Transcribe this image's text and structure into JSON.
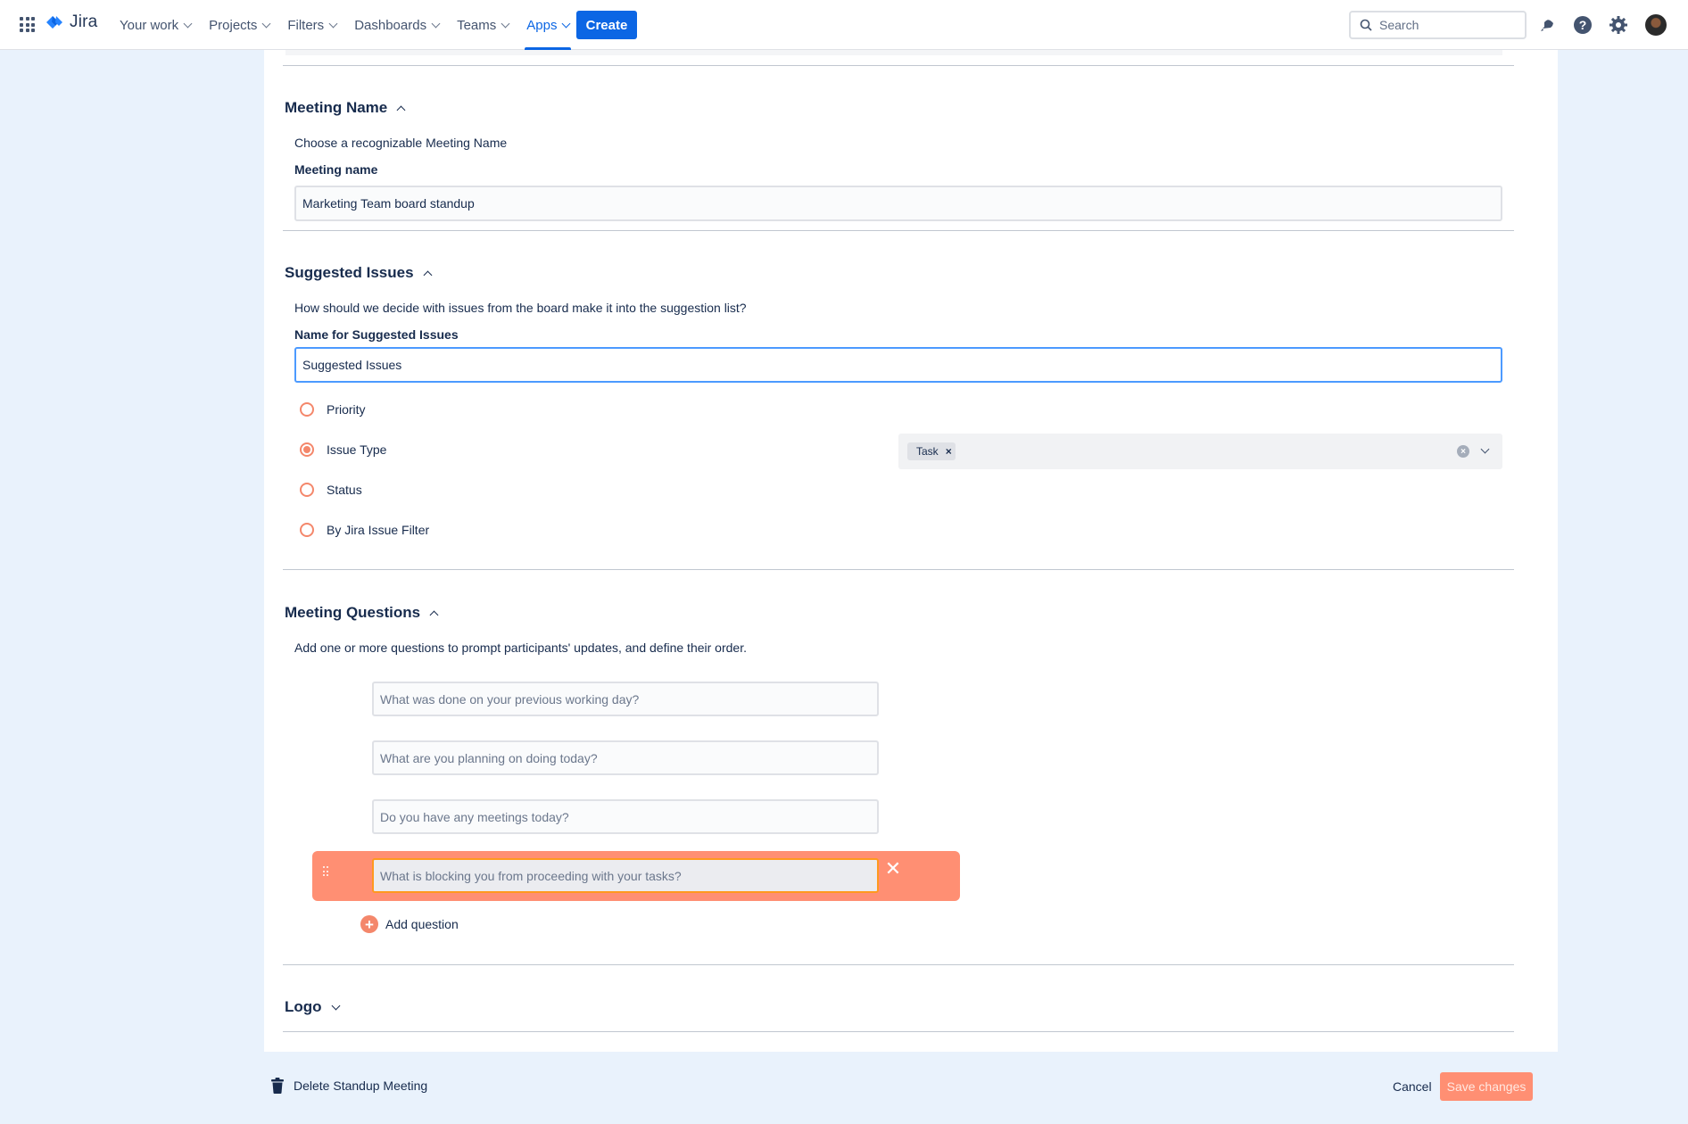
{
  "nav": {
    "logo_text": "Jira",
    "items": [
      {
        "label": "Your work"
      },
      {
        "label": "Projects"
      },
      {
        "label": "Filters"
      },
      {
        "label": "Dashboards"
      },
      {
        "label": "Teams"
      },
      {
        "label": "Apps"
      }
    ],
    "create_label": "Create",
    "search_placeholder": "Search"
  },
  "sections": {
    "meeting_name": {
      "title": "Meeting Name",
      "description": "Choose a recognizable Meeting Name",
      "field_label": "Meeting name",
      "field_value": "Marketing Team board standup"
    },
    "suggested_issues": {
      "title": "Suggested Issues",
      "description": "How should we decide with issues from the board make it into the suggestion list?",
      "field_label": "Name for Suggested Issues",
      "field_value": "Suggested Issues",
      "options": [
        {
          "label": "Priority",
          "checked": false
        },
        {
          "label": "Issue Type",
          "checked": true
        },
        {
          "label": "Status",
          "checked": false
        },
        {
          "label": "By Jira Issue Filter",
          "checked": false
        }
      ],
      "issue_type_tag": "Task"
    },
    "meeting_questions": {
      "title": "Meeting Questions",
      "description": "Add one or more questions to prompt participants' updates, and define their order.",
      "questions": [
        "What was done on your previous working day?",
        "What are you planning on doing today?",
        "Do you have any meetings today?",
        "What is blocking you from proceeding with your tasks?"
      ],
      "add_label": "Add question"
    },
    "logo": {
      "title": "Logo"
    }
  },
  "footer": {
    "delete_label": "Delete Standup Meeting",
    "cancel_label": "Cancel",
    "save_label": "Save changes"
  },
  "colors": {
    "accent": "#0c66e4",
    "radio": "#f4876b",
    "drag_highlight": "#ff8f73"
  }
}
